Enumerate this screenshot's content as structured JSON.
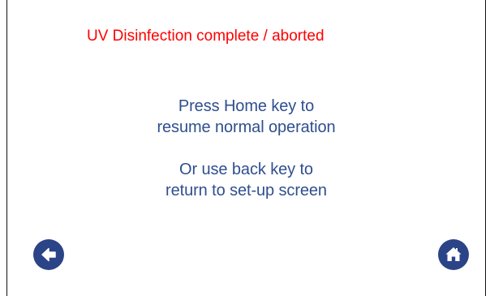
{
  "status": {
    "title": "UV Disinfection complete / aborted",
    "color": "#ff0000"
  },
  "instructions": {
    "home": [
      "Press Home key to",
      "resume normal operation"
    ],
    "back": [
      "Or use back key to",
      "return to set-up screen"
    ]
  },
  "buttons": {
    "back": {
      "icon": "arrow-left-icon"
    },
    "home": {
      "icon": "home-icon"
    }
  },
  "colors": {
    "text": "#2f4f8f",
    "button": "#2b4387"
  }
}
